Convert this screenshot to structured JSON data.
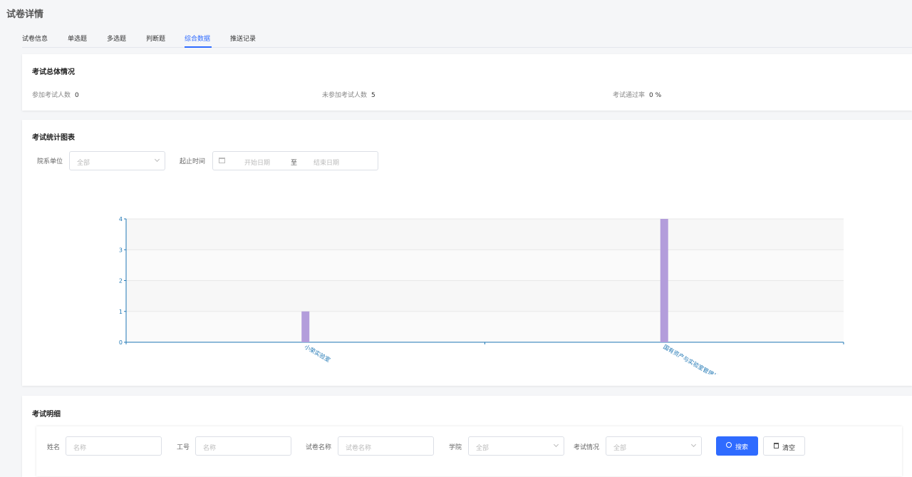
{
  "page": {
    "title": "试卷详情"
  },
  "tabs": [
    {
      "label": "试卷信息"
    },
    {
      "label": "单选题"
    },
    {
      "label": "多选题"
    },
    {
      "label": "判断题"
    },
    {
      "label": "综合数据",
      "active": true
    },
    {
      "label": "推送记录"
    }
  ],
  "overview": {
    "title": "考试总体情况",
    "stats": [
      {
        "label": "参加考试人数",
        "value": "0"
      },
      {
        "label": "未参加考试人数",
        "value": "5"
      },
      {
        "label": "考试通过率",
        "value": "0 %"
      }
    ]
  },
  "statsChart": {
    "title": "考试统计图表",
    "filters": {
      "dept_label": "院系单位",
      "dept_placeholder": "全部",
      "time_label": "起止时间",
      "start_placeholder": "开始日期",
      "separator": "至",
      "end_placeholder": "结束日期"
    }
  },
  "chart_data": {
    "type": "bar",
    "categories": [
      "小荣实验室",
      "国有资产与实验室管理处"
    ],
    "values": [
      1,
      4
    ],
    "ylim": [
      0,
      4
    ],
    "yticks": [
      0,
      1,
      2,
      3,
      4
    ],
    "grid": true,
    "bar_color": "#b39ddb",
    "axis_color": "#1f77b4"
  },
  "details": {
    "title": "考试明细",
    "filters": {
      "name_label": "姓名",
      "name_placeholder": "名称",
      "id_label": "工号",
      "id_placeholder": "名称",
      "paper_label": "试卷名称",
      "paper_placeholder": "试卷名称",
      "college_label": "学院",
      "college_placeholder": "全部",
      "status_label": "考试情况",
      "status_placeholder": "全部"
    },
    "search_label": "搜索",
    "clear_label": "清空"
  },
  "colors": {
    "primary": "#2f6bff"
  }
}
